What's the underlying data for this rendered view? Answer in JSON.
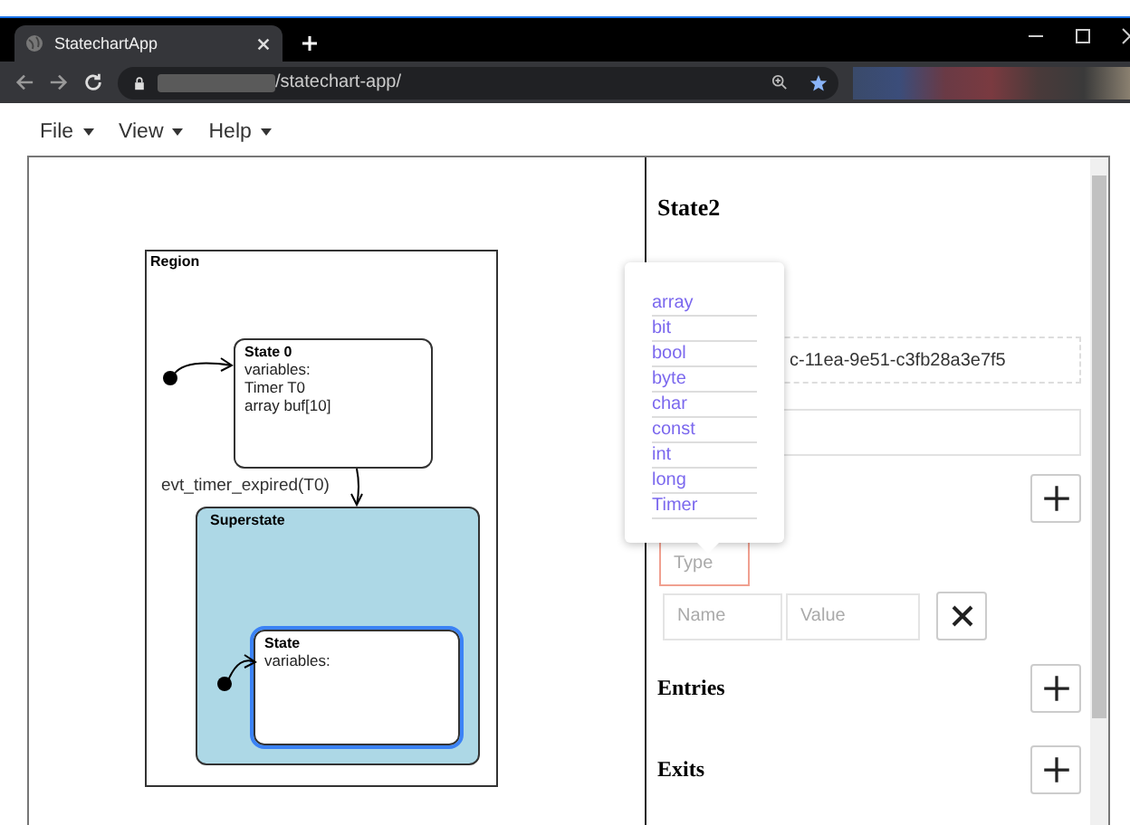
{
  "browser": {
    "tab_title": "StatechartApp",
    "url_path": "/statechart-app/"
  },
  "menu": [
    {
      "label": "File"
    },
    {
      "label": "View"
    },
    {
      "label": "Help"
    }
  ],
  "diagram": {
    "region": "Region",
    "items": [
      {
        "kind": "initial"
      },
      {
        "kind": "state",
        "name": "State 0",
        "variables_label": "variables:",
        "variables": [
          "Timer T0",
          "array buf[10]"
        ],
        "selected": false
      },
      {
        "kind": "transition",
        "label": "evt_timer_expired(T0)"
      },
      {
        "kind": "superstate",
        "name": "Superstate",
        "children": [
          {
            "kind": "initial"
          },
          {
            "kind": "state",
            "name": "State",
            "variables_label": "variables:",
            "selected": true
          }
        ]
      }
    ]
  },
  "panel": {
    "title": "State2",
    "id_value": "c-11ea-9e51-c3fb28a3e7f5",
    "type_options": [
      {
        "label": "array"
      },
      {
        "label": "bit"
      },
      {
        "label": "bool"
      },
      {
        "label": "byte"
      },
      {
        "label": "char"
      },
      {
        "label": "const"
      },
      {
        "label": "int"
      },
      {
        "label": "long"
      },
      {
        "label": "Timer"
      }
    ],
    "type_field": {
      "placeholder": "Type",
      "invalid": true
    },
    "name_field": {
      "placeholder": "Name"
    },
    "value_field": {
      "placeholder": "Value"
    },
    "sections": [
      {
        "title": "Entries"
      },
      {
        "title": "Exits"
      }
    ]
  }
}
